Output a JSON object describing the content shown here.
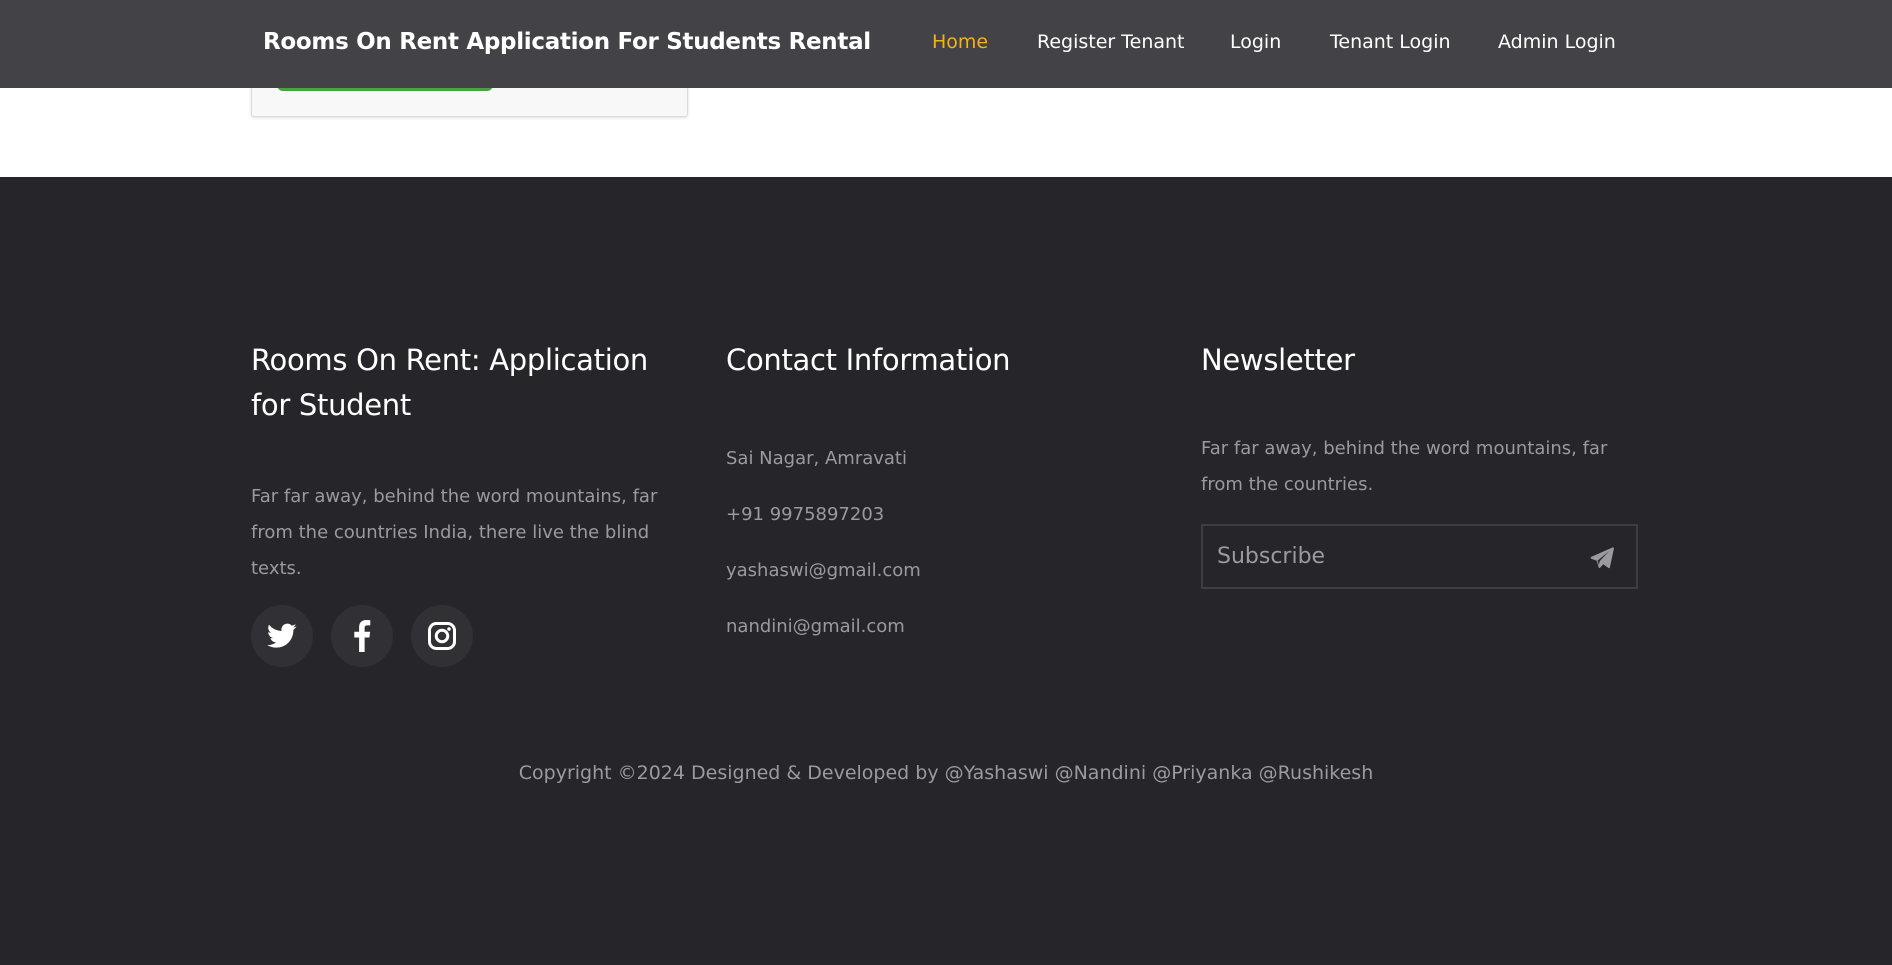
{
  "navbar": {
    "brand": "Rooms On Rent Application For Students Rental",
    "items": [
      {
        "label": "Home",
        "active": true
      },
      {
        "label": "Register Tenant",
        "active": false
      },
      {
        "label": "Login",
        "active": false
      },
      {
        "label": "Tenant Login",
        "active": false
      },
      {
        "label": "Admin Login",
        "active": false
      }
    ],
    "active_color": "#f2b21a",
    "background": "#434247"
  },
  "footer": {
    "about": {
      "heading": "Rooms On Rent: Application for Student",
      "text": "Far far away, behind the word mountains, far from the countries India, there live the blind texts.",
      "socials": [
        "twitter-icon",
        "facebook-icon",
        "instagram-icon"
      ]
    },
    "contact": {
      "heading": "Contact Information",
      "address": "Sai Nagar, Amravati",
      "phone": "+91 9975897203",
      "email1": "yashaswi@gmail.com",
      "email2": "nandini@gmail.com"
    },
    "newsletter": {
      "heading": "Newsletter",
      "text": "Far far away, behind the word mountains, far from the countries.",
      "placeholder": "Subscribe",
      "send_icon": "paper-plane-icon"
    },
    "copyright": "Copyright ©2024 Designed & Developed by @Yashaswi @Nandini @Priyanka @Rushikesh",
    "background": "#26252a"
  },
  "card": {
    "button_color": "#47a340"
  }
}
